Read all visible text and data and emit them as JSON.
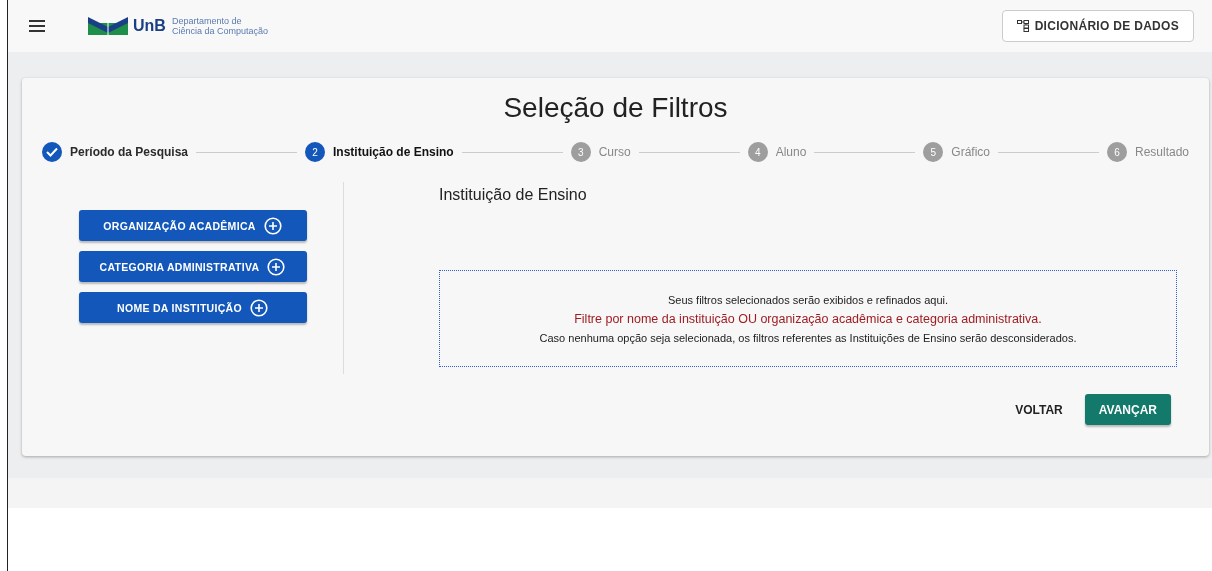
{
  "header": {
    "logo_text": "UnB",
    "department": [
      "Departamento de",
      "Ciência da Computação"
    ],
    "dictionary_button": "DICIONÁRIO DE DADOS"
  },
  "title": "Seleção de Filtros",
  "steps": [
    {
      "label": "Período da Pesquisa",
      "completed": true,
      "selected": false
    },
    {
      "number": "2",
      "label": "Instituição de Ensino",
      "completed": false,
      "selected": true
    },
    {
      "number": "3",
      "label": "Curso",
      "completed": false,
      "selected": false
    },
    {
      "number": "4",
      "label": "Aluno",
      "completed": false,
      "selected": false
    },
    {
      "number": "5",
      "label": "Gráfico",
      "completed": false,
      "selected": false
    },
    {
      "number": "6",
      "label": "Resultado",
      "completed": false,
      "selected": false
    }
  ],
  "filter_buttons": [
    "ORGANIZAÇÃO ACADÊMICA",
    "CATEGORIA ADMINISTRATIVA",
    "NOME DA INSTITUIÇÃO"
  ],
  "section_title": "Instituição de Ensino",
  "notices": [
    {
      "text": "Seus filtros selecionados serão exibidos e refinados aqui.",
      "kind": "info"
    },
    {
      "text": "Filtre por nome da instituição OU organização acadêmica e categoria administrativa.",
      "kind": "highlight"
    },
    {
      "text": "Caso nenhuma opção seja selecionada, os filtros referentes as Instituições de Ensino serão desconsiderados.",
      "kind": "info"
    }
  ],
  "actions": {
    "back": "VOLTAR",
    "next": "AVANÇAR"
  }
}
